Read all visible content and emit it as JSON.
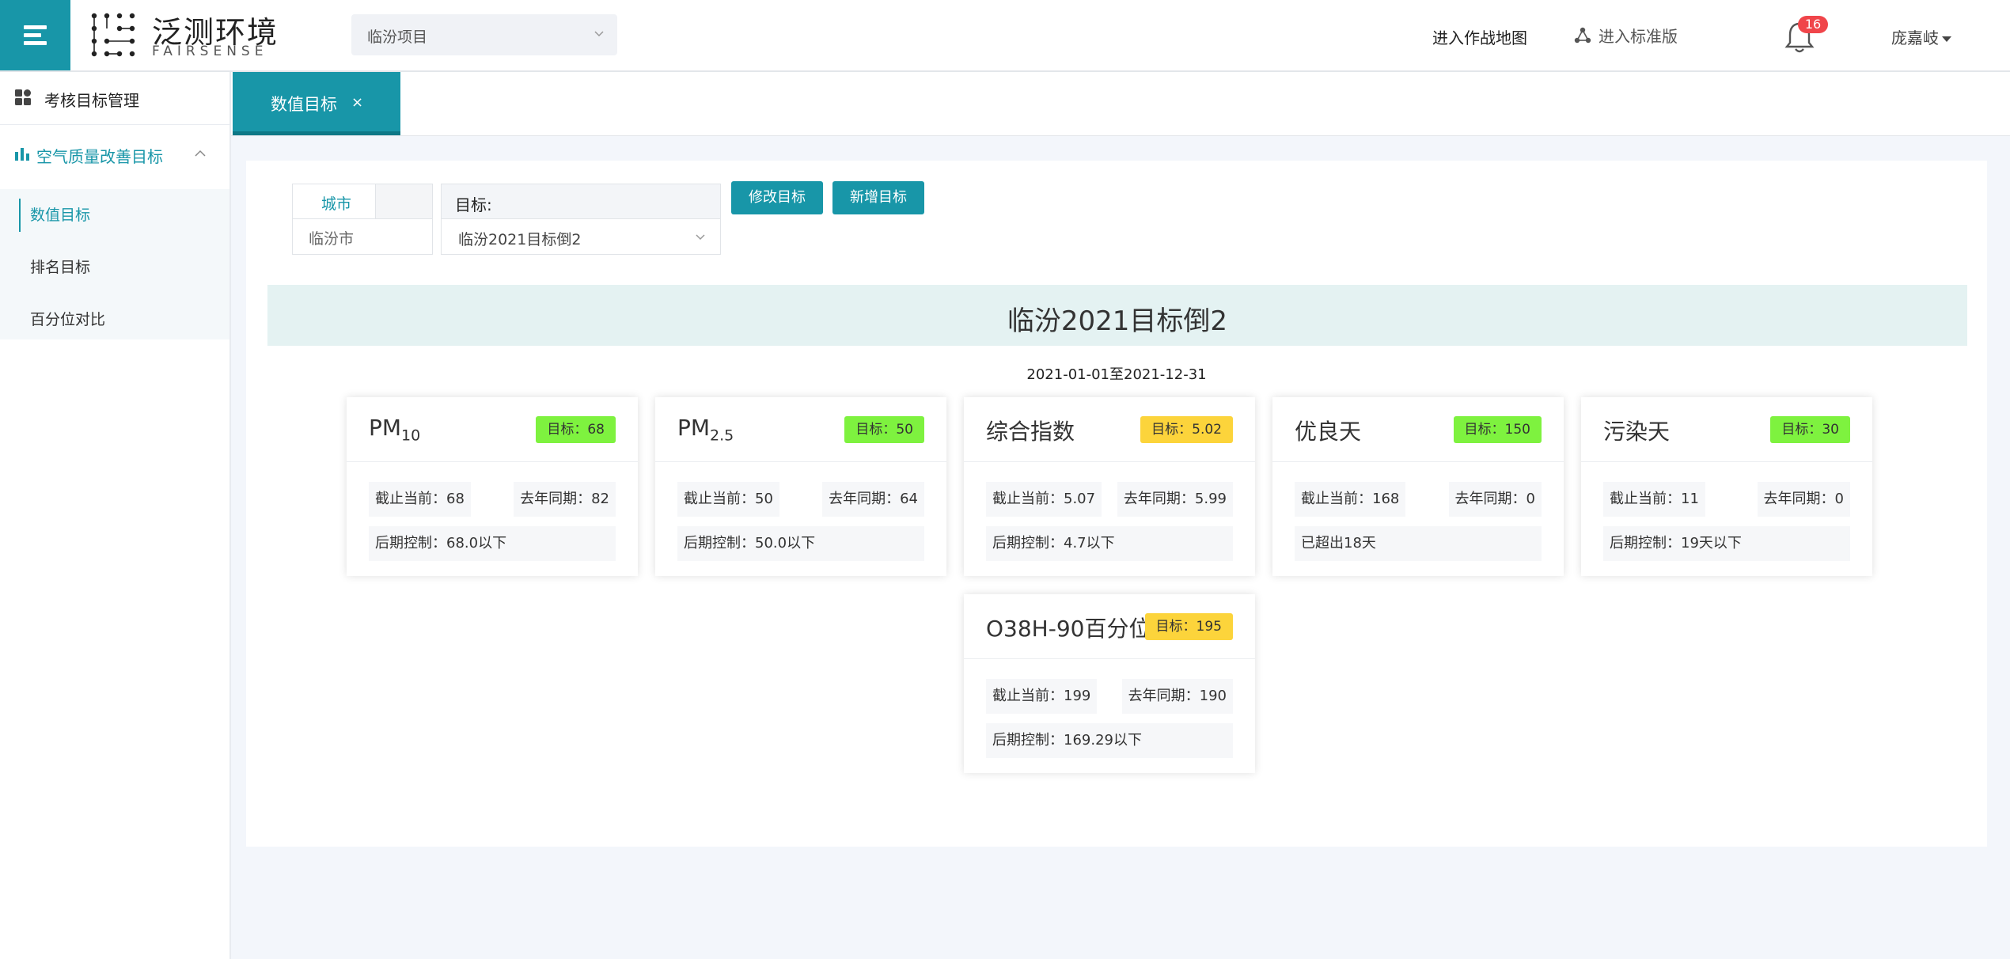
{
  "header": {
    "logo_text": "泛测环境",
    "logo_sub": "FAIRSENSE",
    "project": "临汾项目",
    "nav_map": "进入作战地图",
    "nav_standard": "进入标准版",
    "notification_count": "16",
    "user_name": "庞嘉岐"
  },
  "sidebar": {
    "top_item": "考核目标管理",
    "group": "空气质量改善目标",
    "items": [
      {
        "label": "数值目标"
      },
      {
        "label": "排名目标"
      },
      {
        "label": "百分位对比"
      }
    ]
  },
  "tabs": [
    {
      "label": "数值目标",
      "close": "×"
    }
  ],
  "filters": {
    "city_header": "城市",
    "city_value": "临汾市",
    "target_label": "目标:",
    "target_value": "临汾2021目标倒2",
    "edit_button": "修改目标",
    "add_button": "新增目标"
  },
  "banner_title": "临汾2021目标倒2",
  "date_range": "2021-01-01至2021-12-31",
  "cards": [
    {
      "title": "PM",
      "sub": "10",
      "badge": "目标：68",
      "current": "截止当前：68",
      "last_year": "去年同期：82",
      "control": "后期控制：68.0以下"
    },
    {
      "title": "PM",
      "sub": "2.5",
      "badge": "目标：50",
      "current": "截止当前：50",
      "last_year": "去年同期：64",
      "control": "后期控制：50.0以下"
    },
    {
      "title": "综合指数",
      "sub": "",
      "badge": "目标：5.02",
      "current": "截止当前：5.07",
      "last_year": "去年同期：5.99",
      "control": "后期控制：4.7以下"
    },
    {
      "title": "优良天",
      "sub": "",
      "badge": "目标：150",
      "current": "截止当前：168",
      "last_year": "去年同期：0",
      "control": "已超出18天"
    },
    {
      "title": "污染天",
      "sub": "",
      "badge": "目标：30",
      "current": "截止当前：11",
      "last_year": "去年同期：0",
      "control": "后期控制：19天以下"
    },
    {
      "title": "O38H-90百分位",
      "sub": "",
      "badge": "目标：195",
      "current": "截止当前：199",
      "last_year": "去年同期：190",
      "control": "后期控制：169.29以下"
    }
  ],
  "colors": {
    "accent": "#1896a8",
    "badge_green": "#7ef23f",
    "badge_yellow": "#fcd43b",
    "notification": "#f0454a"
  }
}
